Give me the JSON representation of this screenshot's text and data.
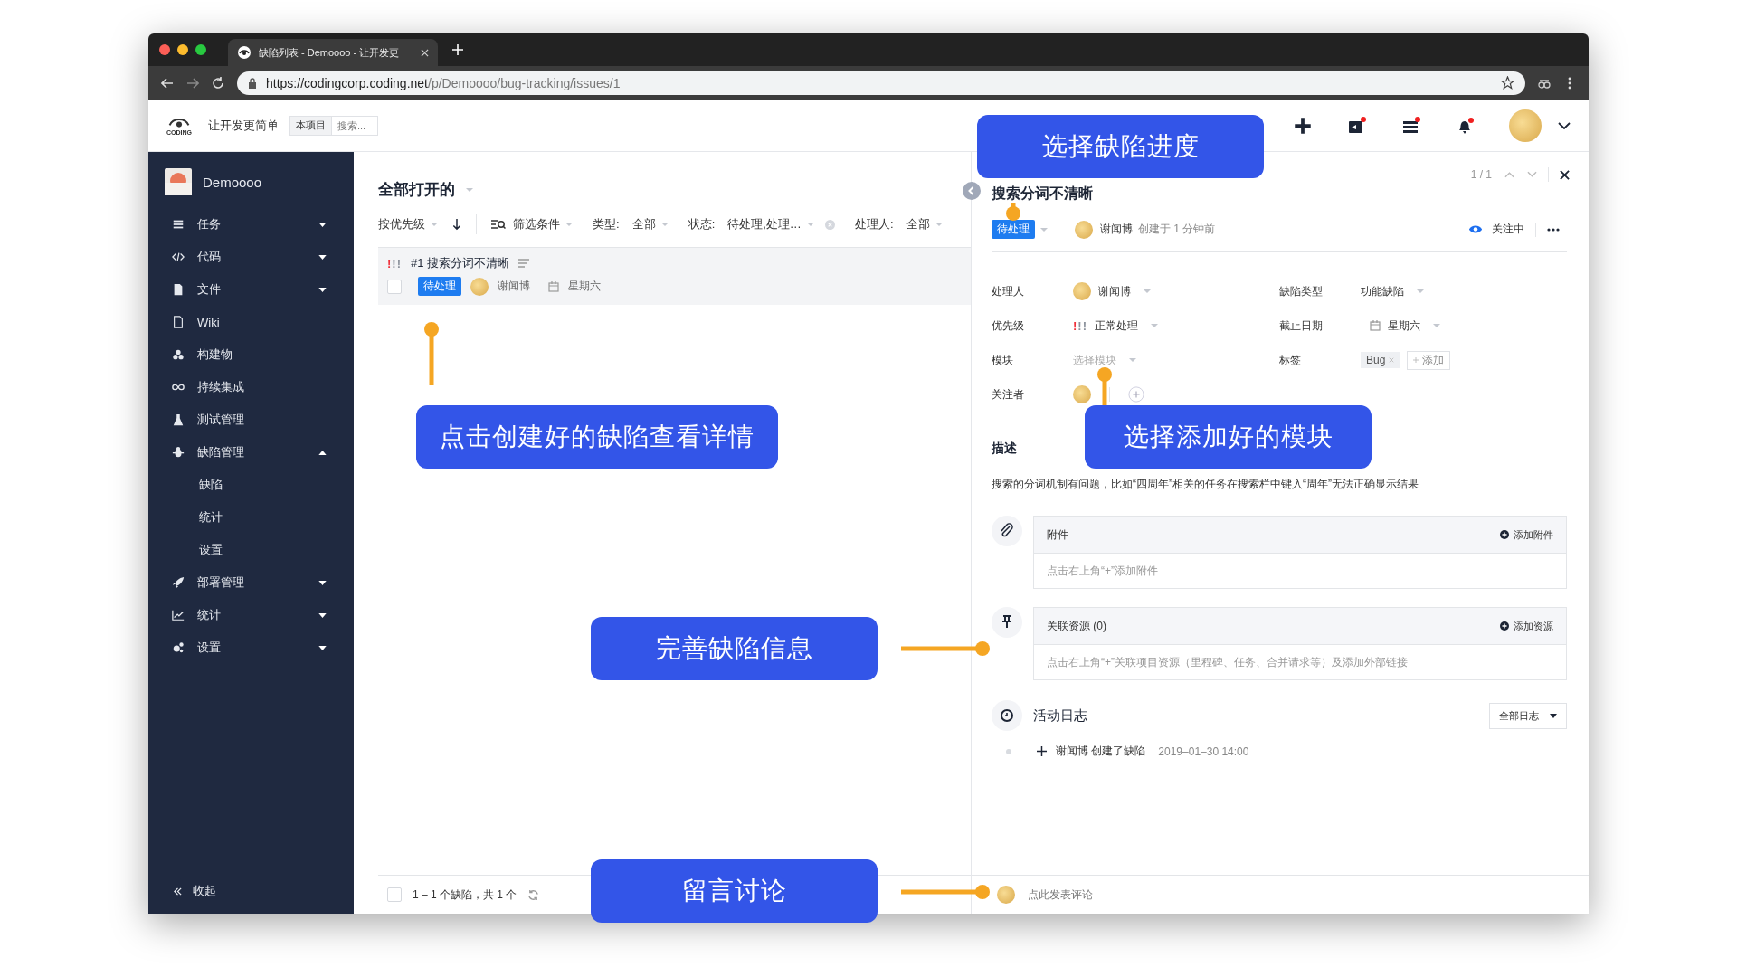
{
  "browser": {
    "tab_title": "缺陷列表 - Demoooo - 让开发更",
    "url_host": "https://codingcorp.coding.net",
    "url_path": "/p/Demoooo/bug-tracking/issues/1"
  },
  "header": {
    "logo_text": "CODING",
    "slogan": "让开发更简单",
    "scope": "本项目",
    "search_placeholder": "搜索..."
  },
  "sidebar": {
    "project": "Demoooo",
    "items": [
      {
        "label": "任务",
        "expanded": false
      },
      {
        "label": "代码",
        "expanded": false
      },
      {
        "label": "文件",
        "expanded": false
      },
      {
        "label": "Wiki"
      },
      {
        "label": "构建物"
      },
      {
        "label": "持续集成"
      },
      {
        "label": "测试管理"
      },
      {
        "label": "缺陷管理",
        "expanded": true,
        "children": [
          {
            "label": "缺陷"
          },
          {
            "label": "统计"
          },
          {
            "label": "设置"
          }
        ]
      },
      {
        "label": "部署管理",
        "expanded": false
      },
      {
        "label": "统计",
        "expanded": false
      },
      {
        "label": "设置",
        "expanded": false
      }
    ],
    "collapse": "收起"
  },
  "list": {
    "title": "全部打开的",
    "sort": "按优先级",
    "filter": "筛选条件",
    "filters": [
      {
        "label": "类型:",
        "value": "全部",
        "clearable": false
      },
      {
        "label": "状态:",
        "value": "待处理,处理…",
        "clearable": true
      },
      {
        "label": "处理人:",
        "value": "全部",
        "clearable": false
      }
    ],
    "issues": [
      {
        "priority": "!!!",
        "title": "#1 搜索分词不清晰",
        "status": "待处理",
        "assignee": "谢闻博",
        "due": "星期六",
        "checked": false
      }
    ],
    "select_all_checked": false,
    "footer": "1 – 1 个缺陷，共 1 个"
  },
  "detail": {
    "pager": "1 / 1",
    "title": "搜索分词不清晰",
    "status": "待处理",
    "author": "谢闻博",
    "created": "创建于 1 分钟前",
    "watch": "关注中",
    "fields": [
      {
        "label": "处理人",
        "kind": "user",
        "value": "谢闻博"
      },
      {
        "label": "缺陷类型",
        "kind": "select",
        "value": "功能缺陷"
      },
      {
        "label": "优先级",
        "kind": "priority",
        "priority": "!!!",
        "value": "正常处理"
      },
      {
        "label": "截止日期",
        "kind": "date",
        "value": "星期六"
      },
      {
        "label": "模块",
        "kind": "placeholder",
        "value": "选择模块"
      },
      {
        "label": "标签",
        "kind": "tags",
        "tags": [
          "Bug"
        ],
        "add": "添加"
      },
      {
        "label": "关注者",
        "kind": "watchers"
      }
    ],
    "description_title": "描述",
    "description": "搜索的分词机制有问题，比如“四周年”相关的任务在搜索栏中键入“周年”无法正确显示结果",
    "attachments": {
      "title": "附件",
      "action": "添加附件",
      "empty": "点击右上角“+”添加附件"
    },
    "resources": {
      "title": "关联资源 (0)",
      "action": "添加资源",
      "empty": "点击右上角“+”关联项目资源（里程碑、任务、合并请求等）及添加外部链接"
    },
    "activity": {
      "title": "活动日志",
      "filter": "全部日志",
      "entries": [
        {
          "text": "谢闻博 创建了缺陷",
          "time": "2019–01–30 14:00"
        }
      ]
    },
    "comment_placeholder": "点此发表评论"
  },
  "annotations": [
    {
      "text": "选择缺陷进度"
    },
    {
      "text": "点击创建好的缺陷查看详情"
    },
    {
      "text": "选择添加好的模块"
    },
    {
      "text": "完善缺陷信息"
    },
    {
      "text": "留言讨论"
    }
  ]
}
